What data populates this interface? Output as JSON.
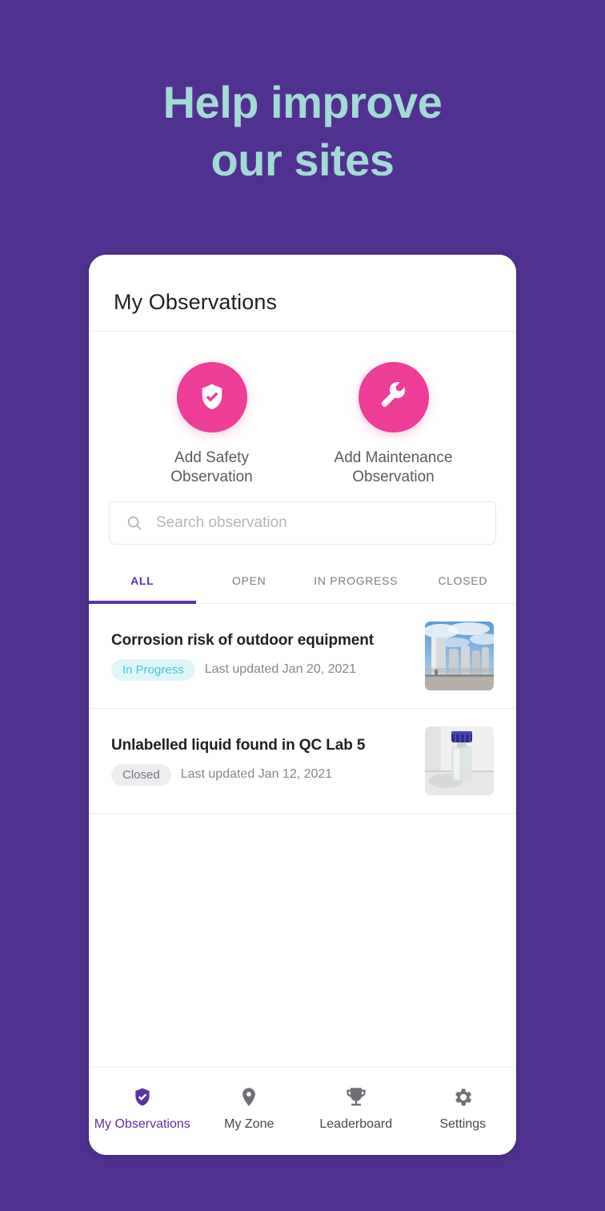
{
  "promo": {
    "background_color": "#51318F",
    "headline_color": "#A2DBD3",
    "headline_line1": "Help improve",
    "headline_line2": "our sites"
  },
  "phone": {
    "status_bar_text": "",
    "header": {
      "title": "My Observations"
    },
    "quick_actions": {
      "accent_color": "#ED3D96",
      "items": [
        {
          "icon": "shield-check-icon",
          "label_line1": "Add Safety",
          "label_line2": "Observation"
        },
        {
          "icon": "wrench-icon",
          "label_line1": "Add Maintenance",
          "label_line2": "Observation"
        }
      ]
    },
    "search": {
      "icon": "search-icon",
      "placeholder": "Search observation",
      "value": ""
    },
    "tabs": {
      "active_color": "#5B33A8",
      "items": [
        {
          "label": "ALL",
          "active": true
        },
        {
          "label": "OPEN",
          "active": false
        },
        {
          "label": "IN PROGRESS",
          "active": false
        },
        {
          "label": "CLOSED",
          "active": false
        }
      ]
    },
    "observations": [
      {
        "title": "Corrosion risk of outdoor equipment",
        "status": "In Progress",
        "status_kind": "in-progress",
        "status_bg": "#DFF6F9",
        "status_fg": "#3FC8DC",
        "updated": "Last updated Jan 20, 2021",
        "thumbnail": "industrial-tanks-photo"
      },
      {
        "title": "Unlabelled liquid found in QC Lab 5",
        "status": "Closed",
        "status_kind": "closed",
        "status_bg": "#EDEDEF",
        "status_fg": "#76777D",
        "updated": "Last updated Jan 12, 2021",
        "thumbnail": "glass-bottle-photo"
      }
    ],
    "bottom_nav": {
      "items": [
        {
          "icon": "shield-check-icon",
          "label": "My Observations",
          "active": true
        },
        {
          "icon": "map-pin-icon",
          "label": "My Zone",
          "active": false
        },
        {
          "icon": "trophy-icon",
          "label": "Leaderboard",
          "active": false
        },
        {
          "icon": "gear-icon",
          "label": "Settings",
          "active": false
        }
      ]
    }
  }
}
